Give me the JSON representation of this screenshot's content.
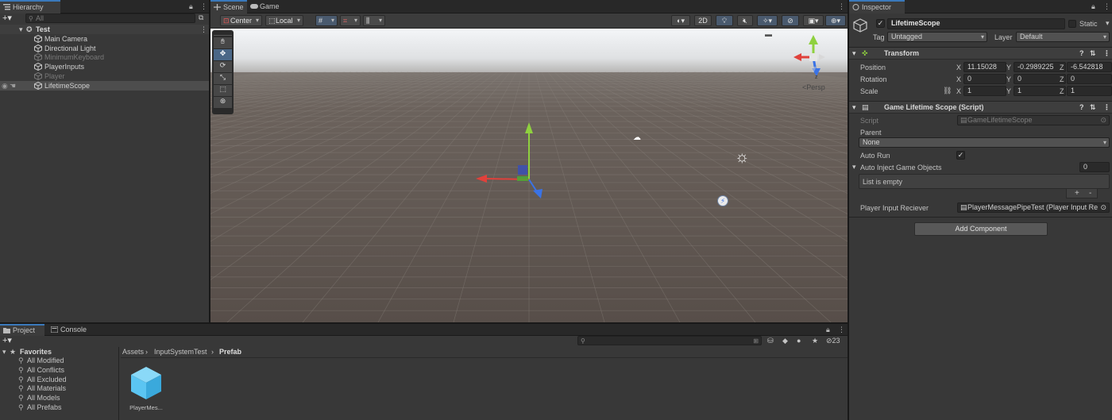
{
  "hierarchy": {
    "tab_label": "Hierarchy",
    "search_placeholder": "All",
    "scene_name": "Test",
    "items": [
      {
        "label": "Main Camera",
        "dim": false
      },
      {
        "label": "Directional Light",
        "dim": false
      },
      {
        "label": "MinimumKeyboard",
        "dim": true
      },
      {
        "label": "PlayerInputs",
        "dim": false
      },
      {
        "label": "Player",
        "dim": true
      },
      {
        "label": "LifetimeScope",
        "dim": false,
        "selected": true
      }
    ]
  },
  "scene": {
    "tabs": [
      "Scene",
      "Game"
    ],
    "pivot_mode": "Center",
    "pivot_rotation": "Local",
    "mode_2d": "2D",
    "persp_label": "<Persp",
    "gizmo_axis_label": "z"
  },
  "inspector": {
    "tab_label": "Inspector",
    "object_name": "LifetimeScope",
    "static_label": "Static",
    "tag_label": "Tag",
    "tag_value": "Untagged",
    "layer_label": "Layer",
    "layer_value": "Default",
    "transform": {
      "title": "Transform",
      "position_label": "Position",
      "rotation_label": "Rotation",
      "scale_label": "Scale",
      "position": {
        "x": "11.15028",
        "y": "-0.2989225",
        "z": "-6.542818"
      },
      "rotation": {
        "x": "0",
        "y": "0",
        "z": "0"
      },
      "scale": {
        "x": "1",
        "y": "1",
        "z": "1"
      }
    },
    "script_component": {
      "title": "Game Lifetime Scope (Script)",
      "script_label": "Script",
      "script_value": "GameLifetimeScope",
      "parent_label": "Parent",
      "parent_value": "None",
      "auto_run_label": "Auto Run",
      "auto_inject_label": "Auto Inject Game Objects",
      "auto_inject_count": "0",
      "list_empty": "List is empty",
      "plus": "+",
      "minus": "-",
      "receiver_label": "Player Input Reciever",
      "receiver_value": "PlayerMessagePipeTest (Player Input Re"
    },
    "add_component": "Add Component"
  },
  "project": {
    "tabs": [
      "Project",
      "Console"
    ],
    "hidden_count": "23",
    "favorites_label": "Favorites",
    "favorites": [
      "All Modified",
      "All Conflicts",
      "All Excluded",
      "All Materials",
      "All Models",
      "All Prefabs"
    ],
    "breadcrumb": [
      "Assets",
      "InputSystemTest",
      "Prefab"
    ],
    "assets": [
      {
        "label": "PlayerMes..."
      }
    ]
  },
  "colors": {
    "selection": "#2c5d87",
    "accent": "#3a79bb",
    "x_axis": "#e0413b",
    "y_axis": "#8fd13f",
    "z_axis": "#3a73e6",
    "asset_blue": "#5bc5f2"
  }
}
